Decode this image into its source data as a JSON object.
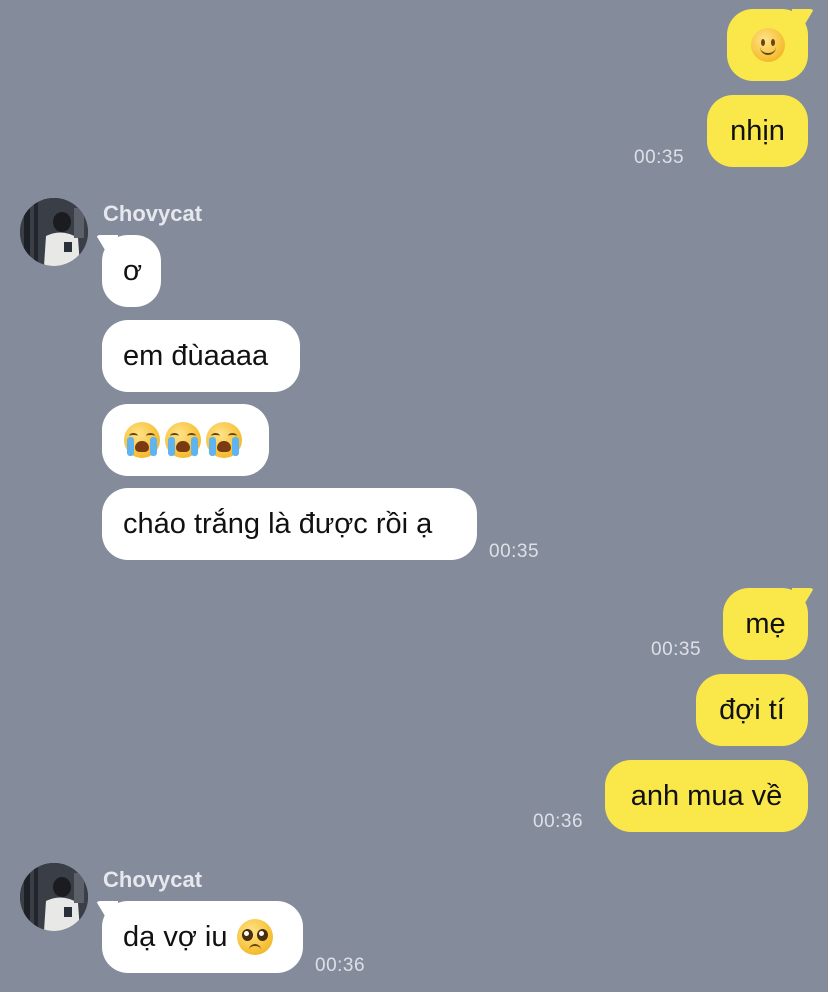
{
  "colors": {
    "background": "#848b9b",
    "my_bubble": "#fae84a",
    "their_bubble": "#ffffff"
  },
  "messages": {
    "m1": {
      "emoji": "slightly-smiling-face"
    },
    "m2": {
      "text": "nhịn",
      "time": "00:35"
    },
    "sender1": {
      "name": "Chovycat"
    },
    "m3": {
      "text": "ơ"
    },
    "m4": {
      "text": "em đùaaaa"
    },
    "m5": {
      "emoji": "loudly-crying-face x3"
    },
    "m6": {
      "text": "cháo trắng là được rồi ạ",
      "time": "00:35"
    },
    "m7": {
      "text": "mẹ",
      "time": "00:35"
    },
    "m8": {
      "text": "đợi tí"
    },
    "m9": {
      "text": "anh mua về",
      "time": "00:36"
    },
    "sender2": {
      "name": "Chovycat"
    },
    "m10": {
      "text": "dạ vợ iu",
      "emoji": "pleading-face",
      "time": "00:36"
    }
  }
}
